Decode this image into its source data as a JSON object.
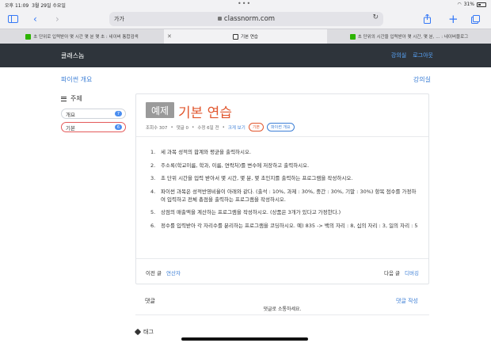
{
  "status_bar": {
    "time": "오후 11:09",
    "date": "3월 29일 수요일",
    "battery": "31%"
  },
  "browser": {
    "address_prefix": "가가",
    "url": "classnorm.com",
    "tabs": [
      {
        "label": "초 단위로 입력받아 몇 시간 몇 분 몇 초 : 네이버 통합검색",
        "active": false,
        "fav_color": "#2db400"
      },
      {
        "label": "기본 연습",
        "active": true,
        "fav_color": "#333333"
      },
      {
        "label": "초 단위의 시간을 입력받아 몇 시간, 몇 분, ... : 네이버블로그",
        "active": false,
        "fav_color": "#2db400"
      }
    ]
  },
  "site": {
    "brand": "클래스놈",
    "nav": {
      "classroom": "강의실",
      "logout": "로그아웃"
    }
  },
  "breadcrumb": {
    "left": "파이썬 개요",
    "right": "강의실"
  },
  "toc": {
    "title": "주제",
    "items": [
      {
        "label": "개요",
        "count": "7",
        "active": false
      },
      {
        "label": "기본",
        "count": "6",
        "active": true
      }
    ]
  },
  "post": {
    "badge": "예제",
    "title": "기본 연습",
    "meta": {
      "views": "조회수 307",
      "comments": "댓글 0",
      "edited": "수정 6일 전",
      "zoom": "크게 보기"
    },
    "tags": [
      "기본",
      "파이썬 개요"
    ],
    "problems": [
      "세 과목 성적의 합계와 평균을 출력하시오.",
      "주소록(학교이름, 학과, 이름, 연락처)를 변수에 저장하고 출력하시오.",
      "초 단위 시간을 입력 받아서 몇 시간, 몇 분, 몇 초인지를 출력하는 프로그램을 작성하시오.",
      "파이썬 과목은 성적반영비율이 아래와 같다. (출석 : 10%, 과제 : 30%, 중간 : 30%, 기말 : 30%) 항목 점수를 가정하여 입력하고 전체 총점을 출력하는 프로그램을 작성하시오.",
      "상점의 매출액을 계산하는 프로그램을 작성하시오. (상품은 3개가 있다고 가정한다.)",
      "정수를 입력받아 각 자리수를 분리하는 프로그램을 코딩하시오. 예) 835 -> 백의 자리 : 8, 십의 자리 : 3, 일의 자리 : 5"
    ],
    "prev": {
      "label": "이전 글",
      "title": "연산자"
    },
    "next": {
      "label": "다음 글",
      "title": "디버깅"
    }
  },
  "comments": {
    "label": "댓글",
    "write": "댓글 작성",
    "hint": "댓글로 소통하세요."
  },
  "tags_section": {
    "label": "태그"
  }
}
